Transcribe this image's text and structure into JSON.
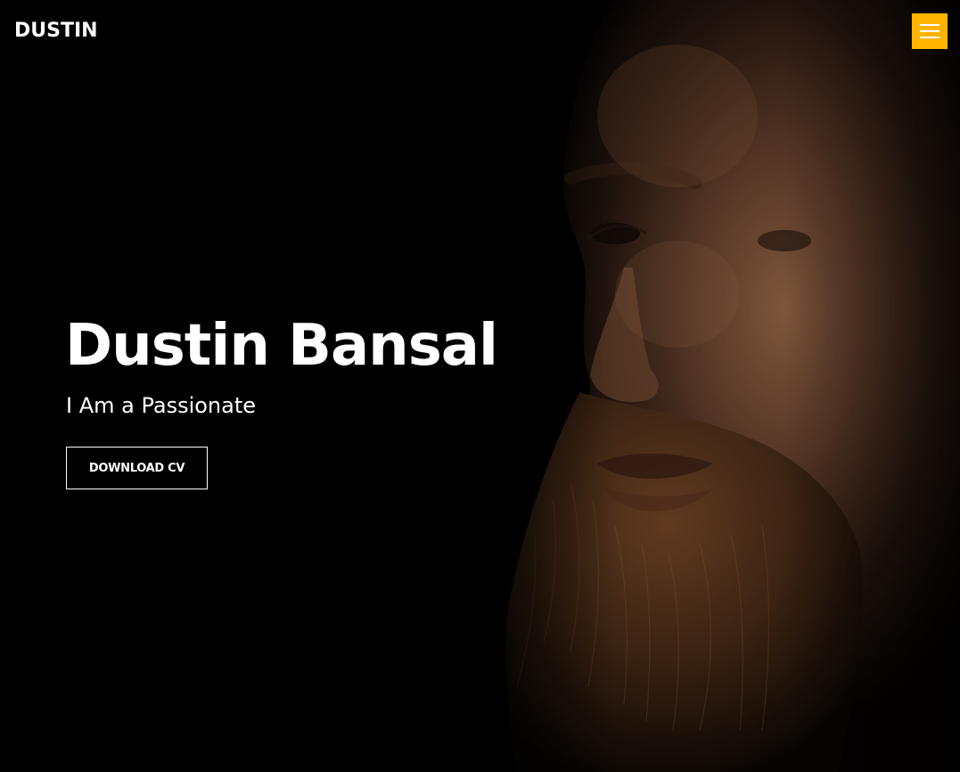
{
  "header": {
    "logo_text": "DUSTIN",
    "menu_icon": "hamburger-menu-icon",
    "accent_color": "#ffb400"
  },
  "hero": {
    "name": "Dustin Bansal",
    "subtitle": "I Am a Passionate",
    "cv_button_label": "DOWNLOAD CV",
    "background_image": "portrait-of-bearded-man"
  }
}
